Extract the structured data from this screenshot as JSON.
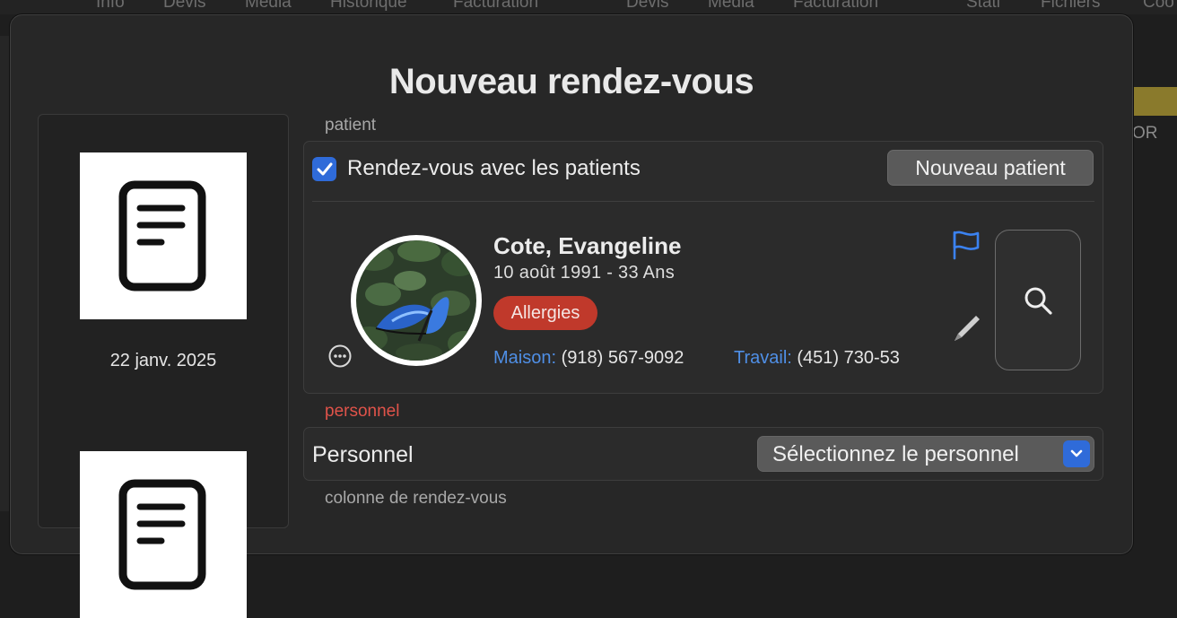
{
  "background": {
    "tabs": [
      "Info",
      "Devis",
      "Média",
      "Historique",
      "Facturation",
      "Devis",
      "Média",
      "Facturation",
      "Stati",
      "Fichiers",
      "Coo"
    ],
    "right_strip_text": "OR"
  },
  "dialog": {
    "title": "Nouveau rendez-vous"
  },
  "documents": {
    "items": [
      {
        "icon": "document-icon",
        "date": "22 janv. 2025"
      },
      {
        "icon": "document-icon",
        "date": ""
      }
    ]
  },
  "patient_section": {
    "label": "patient",
    "checkbox_label": "Rendez-vous avec les patients",
    "checkbox_checked": true,
    "new_patient_button": "Nouveau patient",
    "patient": {
      "name": "Cote, Evangeline",
      "dob": "10 août 1991 - 33 Ans",
      "allergy_badge": "Allergies",
      "home_label": "Maison:",
      "home_phone": "(918) 567-9092",
      "work_label": "Travail:",
      "work_phone": "(451) 730-53"
    }
  },
  "personnel_section": {
    "label": "personnel",
    "field_label": "Personnel",
    "select_value": "Sélectionnez le personnel"
  },
  "column_section": {
    "label": "colonne de rendez-vous"
  },
  "colors": {
    "accent_blue": "#2f6bd9",
    "link_blue": "#4f8fe6",
    "allergy_red": "#c0392b",
    "section_red": "#e0534a"
  }
}
